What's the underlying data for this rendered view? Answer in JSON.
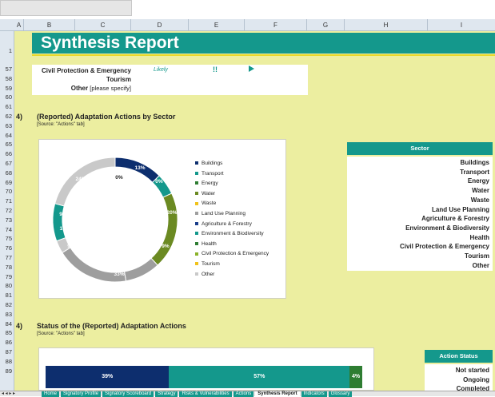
{
  "columns": [
    "A",
    "B",
    "C",
    "D",
    "E",
    "F",
    "G",
    "H",
    "I"
  ],
  "rows": [
    "1",
    "57",
    "58",
    "59",
    "60",
    "61",
    "62",
    "63",
    "64",
    "65",
    "66",
    "67",
    "68",
    "69",
    "70",
    "71",
    "72",
    "73",
    "74",
    "75",
    "76",
    "77",
    "78",
    "79",
    "80",
    "81",
    "82",
    "83",
    "84",
    "85",
    "86",
    "87",
    "88",
    "89"
  ],
  "title": "Synthesis Report",
  "top_rows": [
    {
      "label": "Civil Protection & Emergency",
      "likely": "Likely",
      "mark": "!!"
    },
    {
      "label": "Tourism"
    },
    {
      "label": "Other",
      "placeholder": "[please specify]"
    }
  ],
  "section4a": {
    "num": "4)",
    "title": "(Reported) Adaptation Actions by Sector",
    "source": "[Source: \"Actions\" tab]"
  },
  "donut": {
    "labels": [
      "13%",
      "0%",
      "20%",
      "9%",
      "33%",
      "9%",
      "10%",
      "9%",
      "24%",
      "0%"
    ],
    "legend": [
      {
        "name": "Buildings",
        "color": "#0d2e6e"
      },
      {
        "name": "Transport",
        "color": "#14988c"
      },
      {
        "name": "Energy",
        "color": "#2e7d32"
      },
      {
        "name": "Water",
        "color": "#6b8a22"
      },
      {
        "name": "Waste",
        "color": "#f0c21a"
      },
      {
        "name": "Land Use Planning",
        "color": "#9e9e9e"
      },
      {
        "name": "Agriculture & Forestry",
        "color": "#1a3d8a"
      },
      {
        "name": "Environment & Biodiversity",
        "color": "#14988c"
      },
      {
        "name": "Health",
        "color": "#2e7d32"
      },
      {
        "name": "Civil Protection & Emergency",
        "color": "#8bb22a"
      },
      {
        "name": "Tourism",
        "color": "#f0c21a"
      },
      {
        "name": "Other",
        "color": "#c9c9c9"
      }
    ]
  },
  "sector_table": {
    "header": "Sector",
    "items": [
      "Buildings",
      "Transport",
      "Energy",
      "Water",
      "Waste",
      "Land Use Planning",
      "Agriculture & Forestry",
      "Environment & Biodiversity",
      "Health",
      "Civil Protection & Emergency",
      "Tourism",
      "Other"
    ]
  },
  "section4b": {
    "num": "4)",
    "title": "Status of the (Reported) Adaptation Actions",
    "source": "[Source: \"Actions\" tab]"
  },
  "status_bar": [
    {
      "label": "39%",
      "value": 39,
      "color": "#0d2e6e"
    },
    {
      "label": "57%",
      "value": 57,
      "color": "#14988c"
    },
    {
      "label": "4%",
      "value": 4,
      "color": "#2e7d32"
    }
  ],
  "status_table": {
    "header": "Action Status",
    "items": [
      "Not started",
      "Ongoing",
      "Completed"
    ]
  },
  "tabs": [
    "Home",
    "Signatory Profile",
    "Signatory Scoreboard",
    "Strategy",
    "Risks & Vulnerabilities",
    "Actions",
    "Synthesis Report",
    "Indicators",
    "Glossary"
  ],
  "active_tab": "Synthesis Report"
}
